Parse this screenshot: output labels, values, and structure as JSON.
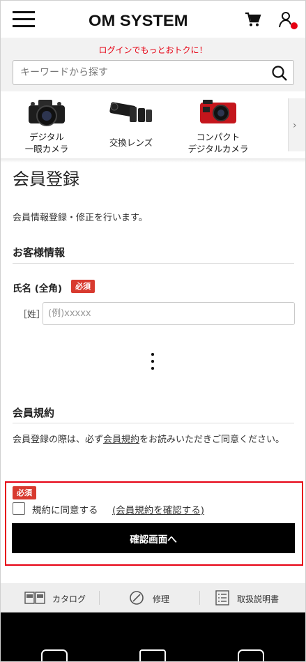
{
  "header": {
    "logo_text": "OM SYSTEM",
    "menu_icon": "hamburger-menu-icon",
    "cart_icon": "cart-icon",
    "user_icon": "user-account-icon",
    "accent_color": "#e60012"
  },
  "login_banner": {
    "text": "ログインでもっとおトクに！"
  },
  "search": {
    "placeholder": "キーワードから探す",
    "value": "",
    "icon": "search-icon"
  },
  "categories": [
    {
      "label_line1": "デジタル",
      "label_line2": "一眼カメラ"
    },
    {
      "label_line1": "交換レンズ",
      "label_line2": ""
    },
    {
      "label_line1": "コンパクト",
      "label_line2": "デジタルカメラ"
    }
  ],
  "main": {
    "title": "会員登録",
    "intro": "会員情報登録・修正を行います。",
    "customer_section_title": "お客様情報",
    "name_field_label": "氏名 (全角)",
    "required_badge": "必須",
    "surname_label": "［姓］",
    "surname_placeholder": "(例)xxxxx",
    "terms_section_title": "会員規約",
    "terms_text_before": "会員登録の際は、必ず",
    "terms_link": "会員規約",
    "terms_text_after": "をお読みいただきご同意ください。",
    "agree_required_badge": "必須",
    "agree_label": "規約に同意する",
    "agree_link": "(会員規約を確認する)",
    "confirm_button": "確認画面へ"
  },
  "footer_nav": [
    {
      "label": "カタログ",
      "icon": "catalog-icon"
    },
    {
      "label": "修理",
      "icon": "repair-icon"
    },
    {
      "label": "取扱説明書",
      "icon": "manual-icon"
    }
  ],
  "footer_social": [
    "om-logo-icon",
    "blog-icon",
    "instagram-icon"
  ]
}
